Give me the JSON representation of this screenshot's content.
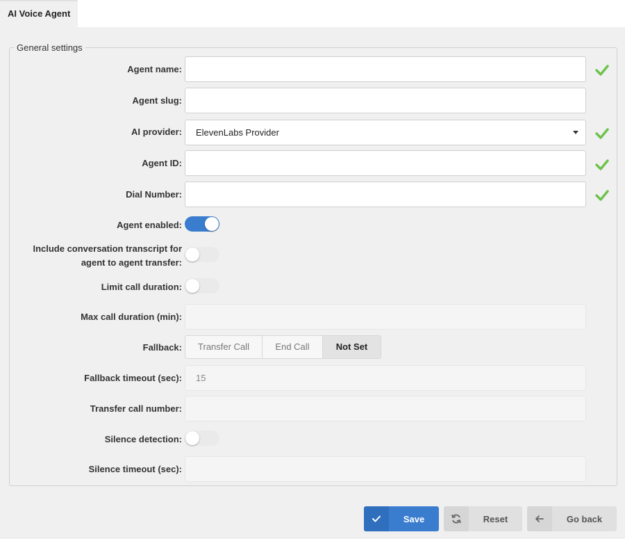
{
  "tab": {
    "title": "AI Voice Agent"
  },
  "section": {
    "legend": "General settings"
  },
  "fields": {
    "agent_name": {
      "label": "Agent name:",
      "value": ""
    },
    "agent_slug": {
      "label": "Agent slug:",
      "value": ""
    },
    "ai_provider": {
      "label": "AI provider:",
      "value": "ElevenLabs Provider"
    },
    "agent_id": {
      "label": "Agent ID:",
      "value": ""
    },
    "dial_number": {
      "label": "Dial Number:",
      "value": ""
    },
    "agent_enabled": {
      "label": "Agent enabled:",
      "on": true
    },
    "include_transcript": {
      "label": "Include conversation transcript for agent to agent transfer:",
      "on": false
    },
    "limit_call_duration": {
      "label": "Limit call duration:",
      "on": false
    },
    "max_call_duration": {
      "label": "Max call duration (min):",
      "value": ""
    },
    "fallback": {
      "label": "Fallback:",
      "options": [
        "Transfer Call",
        "End Call",
        "Not Set"
      ],
      "selected": "Not Set"
    },
    "fallback_timeout": {
      "label": "Fallback timeout (sec):",
      "value": "15"
    },
    "transfer_call_number": {
      "label": "Transfer call number:",
      "value": ""
    },
    "silence_detection": {
      "label": "Silence detection:",
      "on": false
    },
    "silence_timeout": {
      "label": "Silence timeout (sec):",
      "value": ""
    }
  },
  "buttons": {
    "save": "Save",
    "reset": "Reset",
    "go_back": "Go back"
  },
  "colors": {
    "accent": "#3a7dcf",
    "valid": "#6cc24a"
  },
  "icons": {
    "valid": "checkmark-icon",
    "save": "check-icon",
    "reset": "refresh-icon",
    "back": "arrow-left-icon"
  }
}
